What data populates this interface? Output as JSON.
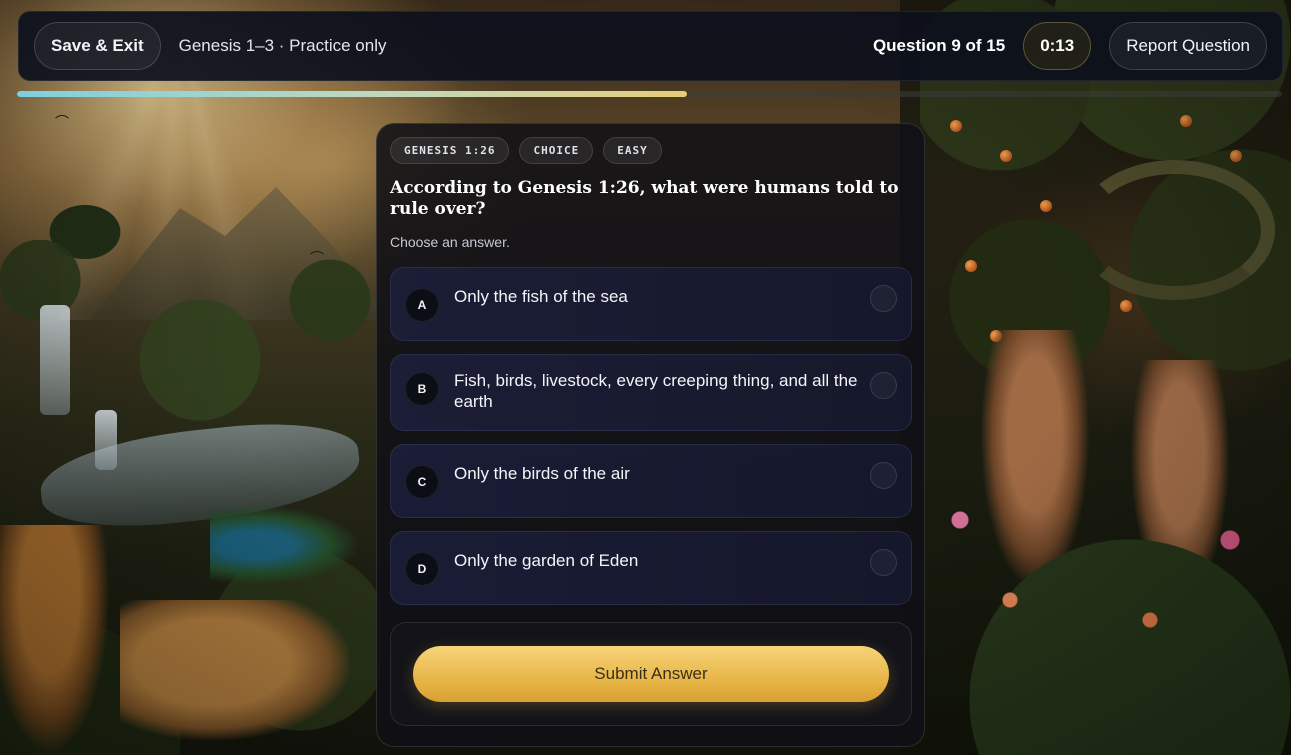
{
  "header": {
    "save_exit_label": "Save & Exit",
    "quiz_title": "Genesis 1–3 · Practice only",
    "question_counter": "Question 9 of 15",
    "timer": "0:13",
    "report_label": "Report Question"
  },
  "progress": {
    "fraction": 0.53
  },
  "question": {
    "tags": [
      "GENESIS 1:26",
      "CHOICE",
      "EASY"
    ],
    "text": "According to Genesis 1:26, what were humans told to rule over?",
    "hint": "Choose an answer.",
    "options": [
      {
        "letter": "A",
        "text": "Only the fish of the sea"
      },
      {
        "letter": "B",
        "text": "Fish, birds, livestock, every creeping thing, and all the earth"
      },
      {
        "letter": "C",
        "text": "Only the birds of the air"
      },
      {
        "letter": "D",
        "text": "Only the garden of Eden"
      }
    ],
    "submit_label": "Submit Answer"
  },
  "theme": {
    "accent_gold": "#e8b648",
    "progress_start": "#7ecfe0",
    "progress_end": "#e6cd7a"
  }
}
